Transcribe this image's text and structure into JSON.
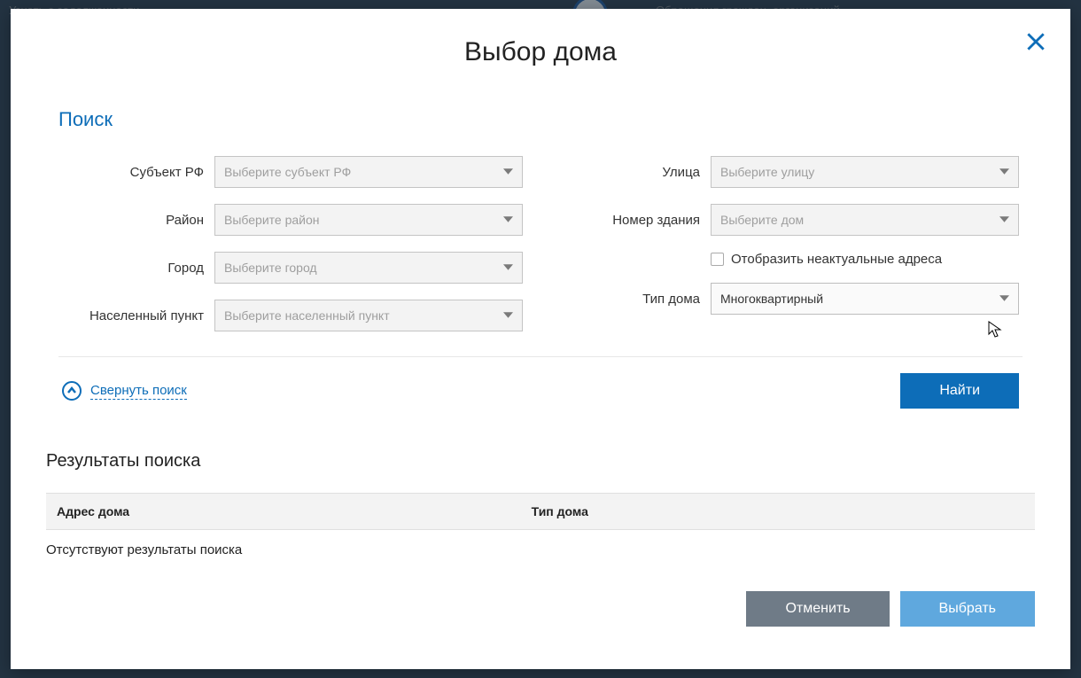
{
  "backdrop": {
    "left_text": "Узнать о задолженности",
    "right_text": "Обращения граждан, организаций"
  },
  "modal": {
    "title": "Выбор дома",
    "section_title": "Поиск",
    "fields": {
      "subject": {
        "label": "Субъект РФ",
        "placeholder": "Выберите субъект РФ"
      },
      "district": {
        "label": "Район",
        "placeholder": "Выберите район"
      },
      "city": {
        "label": "Город",
        "placeholder": "Выберите город"
      },
      "locality": {
        "label": "Населенный пункт",
        "placeholder": "Выберите населенный пункт"
      },
      "street": {
        "label": "Улица",
        "placeholder": "Выберите улицу"
      },
      "building_no": {
        "label": "Номер здания",
        "placeholder": "Выберите дом"
      },
      "show_inactive": {
        "label": "Отобразить неактуальные адреса"
      },
      "house_type": {
        "label": "Тип дома",
        "value": "Многоквартирный"
      }
    },
    "collapse": "Свернуть поиск",
    "search_btn": "Найти",
    "results_title": "Результаты поиска",
    "results_cols": {
      "address": "Адрес дома",
      "type": "Тип дома"
    },
    "empty": "Отсутствуют результаты поиска",
    "cancel_btn": "Отменить",
    "select_btn": "Выбрать"
  }
}
